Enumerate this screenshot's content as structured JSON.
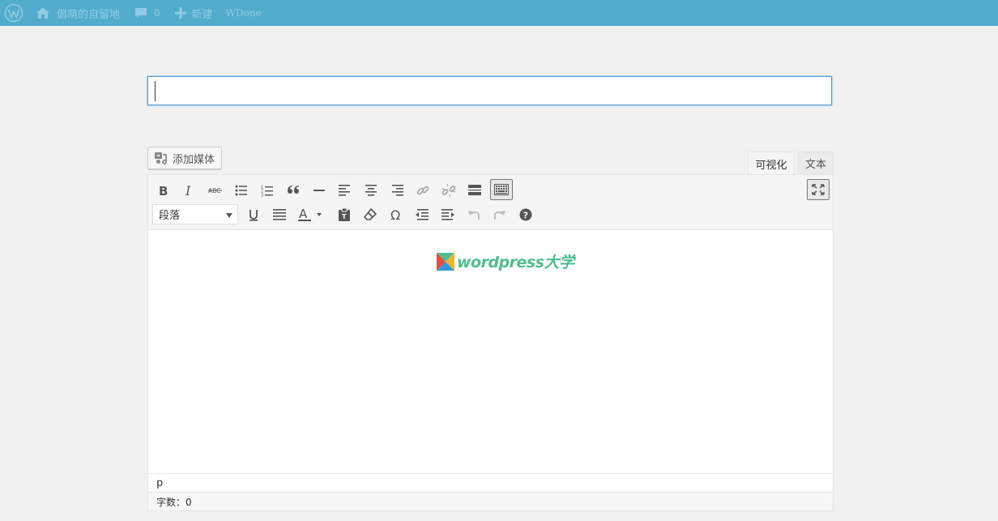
{
  "admin_bar": {
    "site_name": "倡萌的自留地",
    "comment_count": "0",
    "new_label": "新建",
    "user_label": "WDone",
    "icons": [
      "wordpress-logo-icon",
      "home-icon",
      "comment-icon",
      "plus-icon"
    ]
  },
  "title": {
    "value": "",
    "placeholder": ""
  },
  "media": {
    "add_label": "添加媒体"
  },
  "tabs": {
    "visual": "可视化",
    "text": "文本",
    "active": "visual"
  },
  "toolbar": {
    "format_select": "段落",
    "row1": [
      "bold",
      "italic",
      "strikethrough",
      "bullet-list",
      "numbered-list",
      "blockquote",
      "horizontal-rule",
      "align-left",
      "align-center",
      "align-right",
      "link",
      "unlink",
      "read-more",
      "toolbar-toggle"
    ],
    "row2": [
      "underline",
      "justify",
      "text-color",
      "paste-as-text",
      "clear-formatting",
      "special-character",
      "outdent",
      "indent",
      "undo",
      "redo",
      "help"
    ],
    "fullscreen": "fullscreen"
  },
  "content": {
    "logo_text": "wordpress大学"
  },
  "path": {
    "value": "p"
  },
  "status": {
    "word_count": "字数：0"
  },
  "colors": {
    "admin_bar": "#52accc",
    "admin_bar_text": "#8fcbe3",
    "logo_green": "#4fbe8d",
    "focus_border": "#5b9dd9"
  }
}
